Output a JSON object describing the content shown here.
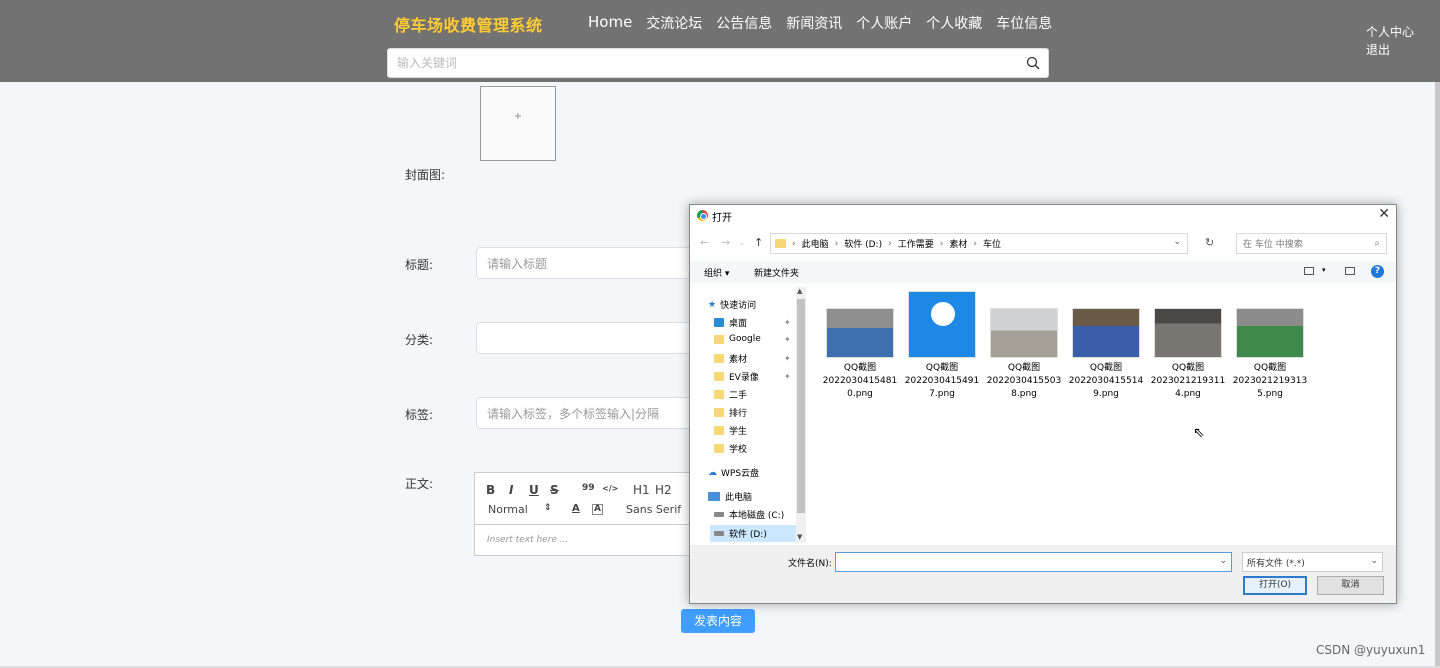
{
  "header": {
    "brand": "停车场收费管理系统",
    "nav": [
      "Home",
      "交流论坛",
      "公告信息",
      "新闻资讯",
      "个人账户",
      "个人收藏",
      "车位信息"
    ],
    "user_links": [
      "个人中心",
      "退出"
    ],
    "search_placeholder": "输入关键词"
  },
  "form": {
    "cover_label": "封面图:",
    "cover_plus": "+",
    "title_label": "标题:",
    "title_placeholder": "请输入标题",
    "category_label": "分类:",
    "tags_label": "标签:",
    "tags_placeholder": "请输入标签，多个标签输入|分隔",
    "content_label": "正文:",
    "editor": {
      "bold": "B",
      "italic": "I",
      "underline": "U",
      "strike": "S",
      "quote": "99",
      "code": "</>",
      "h1": "H1",
      "h2": "H2",
      "size": "Normal",
      "font": "Sans Serif",
      "placeholder": "Insert text here ..."
    },
    "submit": "发表内容"
  },
  "dialog": {
    "title": "打开",
    "address": [
      "此电脑",
      "软件 (D:)",
      "工作需要",
      "素材",
      "车位"
    ],
    "search_placeholder": "在 车位 中搜索",
    "organize": "组织 ▾",
    "new_folder": "新建文件夹",
    "help": "?",
    "tree": [
      {
        "label": "快速访问",
        "type": "star"
      },
      {
        "label": "桌面",
        "type": "desktop",
        "pinned": true
      },
      {
        "label": "Google",
        "type": "folder",
        "pinned": true
      },
      {
        "label": "素材",
        "type": "folder",
        "pinned": true
      },
      {
        "label": "EV录像",
        "type": "folder",
        "pinned": true
      },
      {
        "label": "二手",
        "type": "folder"
      },
      {
        "label": "排行",
        "type": "folder"
      },
      {
        "label": "学生",
        "type": "folder"
      },
      {
        "label": "学校",
        "type": "folder"
      },
      {
        "label": "WPS云盘",
        "type": "cloud"
      },
      {
        "label": "此电脑",
        "type": "pc"
      },
      {
        "label": "本地磁盘 (C:)",
        "type": "drive"
      },
      {
        "label": "软件 (D:)",
        "type": "drive",
        "selected": true
      }
    ],
    "files": [
      {
        "name": "QQ截图20220304154810.png",
        "l1": "QQ截图",
        "l2": "2022030415481",
        "l3": "0.png",
        "color": "#3d6fb0"
      },
      {
        "name": "QQ截图20220304154917.png",
        "l1": "QQ截图",
        "l2": "2022030415491",
        "l3": "7.png",
        "color": "#1e88e5"
      },
      {
        "name": "QQ截图20220304155038.png",
        "l1": "QQ截图",
        "l2": "2022030415503",
        "l3": "8.png",
        "color": "#b0a8a0"
      },
      {
        "name": "QQ截图20220304155149.png",
        "l1": "QQ截图",
        "l2": "2022030415514",
        "l3": "9.png",
        "color": "#3a5fa8"
      },
      {
        "name": "QQ截图20230212193114.png",
        "l1": "QQ截图",
        "l2": "2023021219311",
        "l3": "4.png",
        "color": "#6d6a66"
      },
      {
        "name": "QQ截图20230212193135.png",
        "l1": "QQ截图",
        "l2": "2023021219313",
        "l3": "5.png",
        "color": "#3f8a4a"
      }
    ],
    "filename_label": "文件名(N):",
    "filetype": "所有文件 (*.*)",
    "open": "打开(O)",
    "cancel": "取消"
  },
  "watermark": "CSDN @yuyuxun1"
}
